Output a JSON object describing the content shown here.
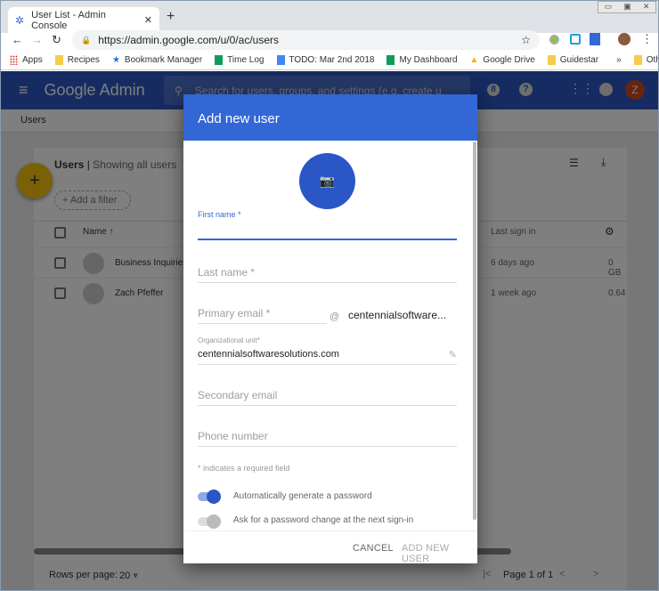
{
  "browser": {
    "tab_title": "User List - Admin Console",
    "url": "https://admin.google.com/u/0/ac/users",
    "bookmarks": [
      {
        "label": "Apps",
        "icon": "apps-grid-icon",
        "color": "#e8453c"
      },
      {
        "label": "Recipes",
        "icon": "folder-icon",
        "color": "#f7cb4d"
      },
      {
        "label": "Bookmark Manager",
        "icon": "star-icon",
        "color": "#1a73e8"
      },
      {
        "label": "Time Log",
        "icon": "sheets-icon",
        "color": "#0f9d58"
      },
      {
        "label": "TODO: Mar 2nd 2018",
        "icon": "docs-icon",
        "color": "#4285f4"
      },
      {
        "label": "My Dashboard",
        "icon": "sheets-icon",
        "color": "#0f9d58"
      },
      {
        "label": "Google Drive",
        "icon": "drive-icon",
        "color": "#f4b400"
      },
      {
        "label": "Guidestar",
        "icon": "folder-icon",
        "color": "#f7cb4d"
      }
    ],
    "more": "»",
    "other_bookmarks": "Other bookmarks"
  },
  "app": {
    "title": "Google Admin",
    "search_placeholder": "Search for users, groups, and settings (e.g. create u",
    "avatar_letter": "Z",
    "badge": "8",
    "breadcrumb": "Users"
  },
  "users": {
    "title": "Users",
    "subtitle": "Showing all users",
    "add_filter": "Add a filter",
    "col_name": "Name",
    "col_last_sign_in": "Last sign in",
    "rows": [
      {
        "name": "Business Inquiries",
        "last": "6 days ago",
        "storage": "0 GB"
      },
      {
        "name": "Zach Pfeffer",
        "last": "1 week ago",
        "storage": "0.64"
      }
    ],
    "rows_per_page_label": "Rows per page:",
    "rows_per_page": "20",
    "page_info": "Page 1 of 1"
  },
  "dialog": {
    "title": "Add new user",
    "first_name": "First name *",
    "last_name": "Last name *",
    "primary_email": "Primary email *",
    "at": "@",
    "domain": "centennialsoftware...",
    "org_unit_label": "Organizational unit*",
    "org_unit_value": "centennialsoftwaresolutions.com",
    "secondary_email": "Secondary email",
    "phone": "Phone number",
    "required_note": "* indicates a required field",
    "auto_password": "Automatically generate a password",
    "ask_change": "Ask for a password change at the next sign-in",
    "cancel": "CANCEL",
    "add": "ADD NEW USER",
    "auto_password_on": true,
    "ask_change_on": false
  },
  "colors": {
    "accent": "#3367d6",
    "header": "#2c57c2",
    "fab": "#f4c20d"
  }
}
